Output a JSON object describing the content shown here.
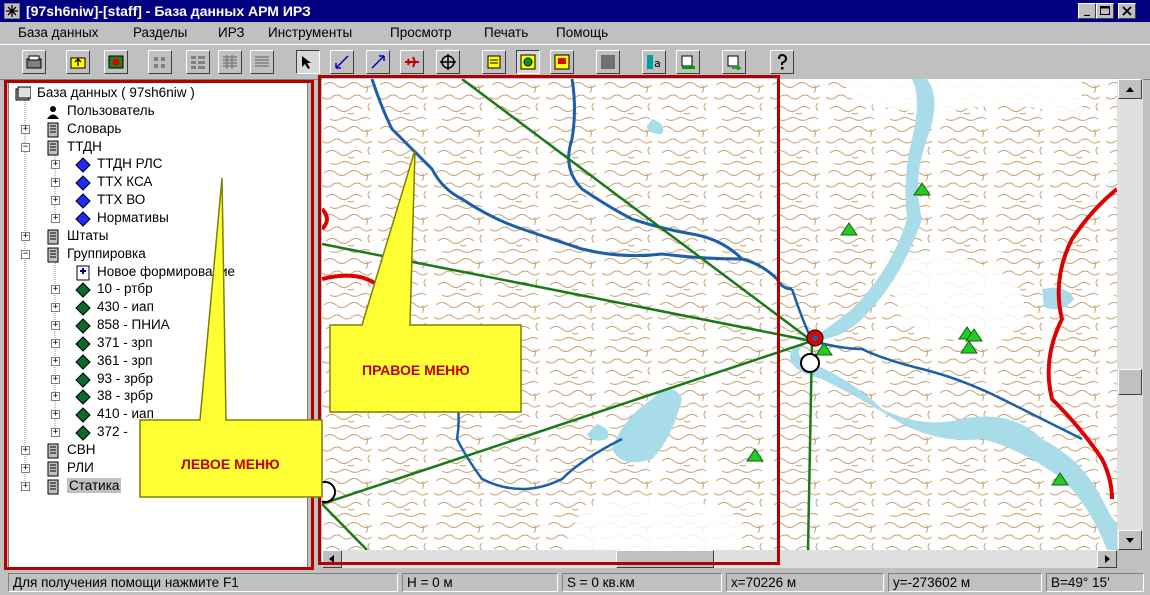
{
  "window": {
    "title": "[97sh6niw]-[staff] - База данных АРМ ИРЗ",
    "controls": [
      "minimize",
      "maximize",
      "close"
    ]
  },
  "menu": {
    "items": [
      "База данных",
      "Разделы",
      "ИРЗ",
      "Инструменты",
      "Просмотр",
      "Печать",
      "Помощь"
    ]
  },
  "toolbar": {
    "buttons": [
      "open-icon",
      "folder-up-icon",
      "map-icon",
      "grid-small-icon",
      "grid-medium-icon",
      "grid-large-icon",
      "list-icon",
      "select-arrow-icon",
      "line-arrow-blue-icon",
      "line-arrow-icon",
      "aircraft-icon",
      "crosshair-icon",
      "note-yellow-icon",
      "radar-icon",
      "layer-icon",
      "stop-icon",
      "text-tool-icon",
      "print-icon",
      "export-icon",
      "help-icon"
    ],
    "pressed": "select-arrow-icon"
  },
  "tree": {
    "items": [
      {
        "label": "База данных ( 97sh6niw )",
        "level": 0,
        "expander": "",
        "icon": "database-icon"
      },
      {
        "label": "Пользователь",
        "level": 1,
        "expander": "",
        "icon": "user-icon"
      },
      {
        "label": "Словарь",
        "level": 0,
        "expander": "+",
        "icon": "server-icon"
      },
      {
        "label": "ТТДН",
        "level": 0,
        "expander": "-",
        "icon": "server-icon"
      },
      {
        "label": "ТТДН РЛС",
        "level": 1,
        "expander": "+",
        "icon": "diamond-blue-icon"
      },
      {
        "label": "ТТХ КСА",
        "level": 1,
        "expander": "+",
        "icon": "diamond-blue-icon"
      },
      {
        "label": "ТТХ ВО",
        "level": 1,
        "expander": "+",
        "icon": "diamond-blue-icon"
      },
      {
        "label": "Нормативы",
        "level": 1,
        "expander": "+",
        "icon": "diamond-blue-icon"
      },
      {
        "label": "Штаты",
        "level": 0,
        "expander": "+",
        "icon": "server-icon"
      },
      {
        "label": "Группировка",
        "level": 0,
        "expander": "-",
        "icon": "server-icon"
      },
      {
        "label": "Новое формирование",
        "level": 1,
        "expander": "",
        "icon": "new-doc-icon"
      },
      {
        "label": "10 - ртбр",
        "level": 1,
        "expander": "+",
        "icon": "diamond-green-icon"
      },
      {
        "label": "430 - иап",
        "level": 1,
        "expander": "+",
        "icon": "diamond-green-icon"
      },
      {
        "label": "858 - ПНИА",
        "level": 1,
        "expander": "+",
        "icon": "diamond-green-icon"
      },
      {
        "label": "371 - зрп",
        "level": 1,
        "expander": "+",
        "icon": "diamond-green-icon"
      },
      {
        "label": "361 - зрп",
        "level": 1,
        "expander": "+",
        "icon": "diamond-green-icon"
      },
      {
        "label": "93 - зрбр",
        "level": 1,
        "expander": "+",
        "icon": "diamond-green-icon"
      },
      {
        "label": "38 - зрбр",
        "level": 1,
        "expander": "+",
        "icon": "diamond-green-icon"
      },
      {
        "label": "410 - иап",
        "level": 1,
        "expander": "+",
        "icon": "diamond-green-icon"
      },
      {
        "label": "372 -",
        "level": 1,
        "expander": "+",
        "icon": "diamond-green-icon"
      },
      {
        "label": "СВН",
        "level": 0,
        "expander": "+",
        "icon": "server-icon"
      },
      {
        "label": "РЛИ",
        "level": 0,
        "expander": "+",
        "icon": "server-icon"
      },
      {
        "label": "Статика",
        "level": 0,
        "expander": "+",
        "icon": "server-icon",
        "selected": true
      }
    ]
  },
  "annotations": {
    "left_label": "ЛЕВОЕ МЕНЮ",
    "right_label": "ПРАВОЕ МЕНЮ",
    "callout_color": "#ffff33",
    "frame_color": "#b00000"
  },
  "map": {
    "lake_color": "#a8dce8",
    "river_color": "#1a5fa8",
    "contour_color": "#c8a070",
    "border_color": "#e00000",
    "bearing_color": "#1a7a1a",
    "marker_color": "#22cc22"
  },
  "status": {
    "help": "Для получения помощи нажмите F1",
    "height": "H = 0 м",
    "area": "S = 0  кв.км",
    "x": "x=70226 м",
    "y": "y=-273602 м",
    "b": "B=49° 15'"
  }
}
